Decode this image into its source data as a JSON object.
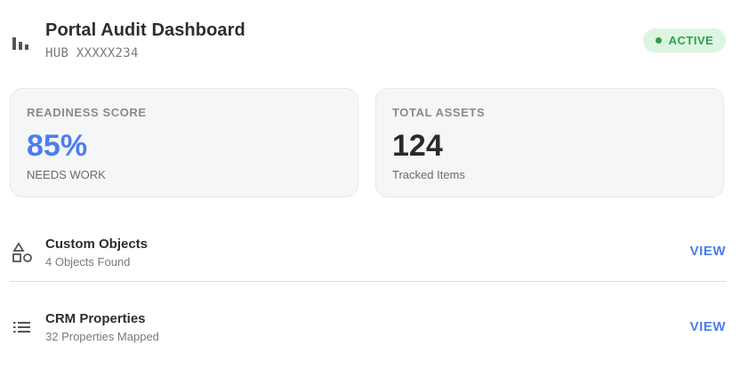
{
  "header": {
    "title": "Portal Audit Dashboard",
    "subtitle": "HUB XXXXX234",
    "logo_icon": "bar-chart-icon",
    "status": {
      "label": "ACTIVE",
      "color": "#2f9e52",
      "background": "#dcf5e1"
    }
  },
  "cards": [
    {
      "label": "READINESS SCORE",
      "value": "85%",
      "sub": "NEEDS WORK",
      "value_color": "#4b7df0"
    },
    {
      "label": "TOTAL ASSETS",
      "value": "124",
      "sub": "Tracked Items",
      "value_color": "#2a2a2a"
    }
  ],
  "items": [
    {
      "title": "Custom Objects",
      "sub": "4 Objects Found",
      "action": "VIEW",
      "icon": "shapes-icon"
    },
    {
      "title": "CRM Properties",
      "sub": "32 Properties Mapped",
      "action": "VIEW",
      "icon": "list-icon"
    }
  ],
  "colors": {
    "accent": "#4b7df0",
    "success": "#2f9e52"
  }
}
